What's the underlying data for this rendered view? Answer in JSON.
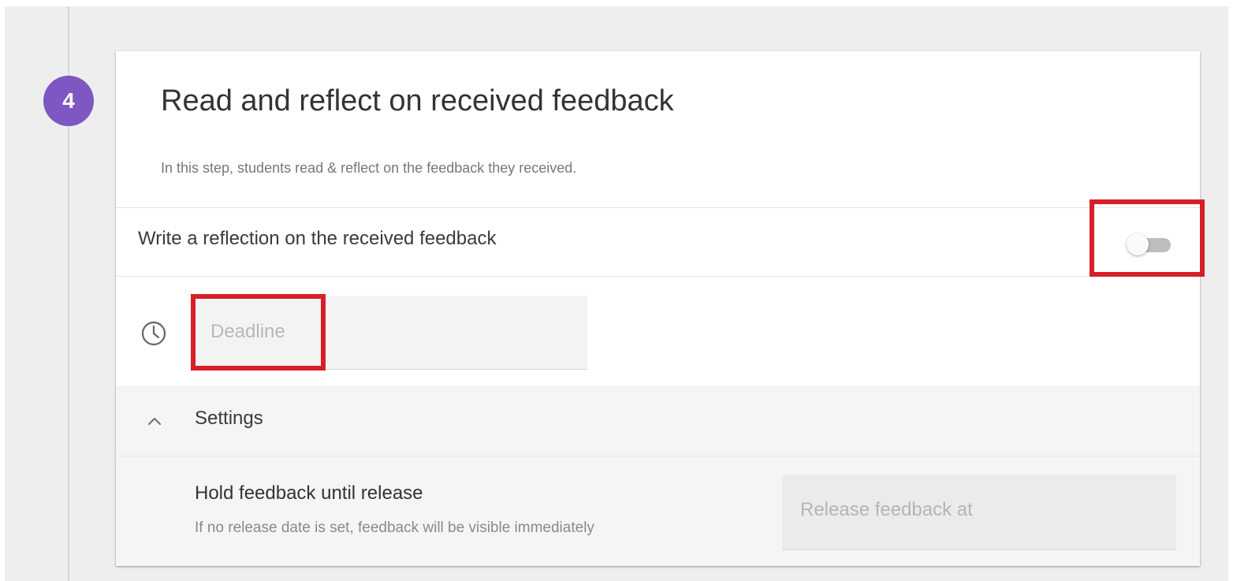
{
  "step": {
    "number": "4",
    "title": "Read and reflect on received feedback",
    "description": "In this step, students read & reflect on the feedback they received."
  },
  "reflection": {
    "label": "Write a reflection on the received feedback",
    "enabled": false
  },
  "deadline": {
    "icon": "clock-icon",
    "placeholder": "Deadline"
  },
  "settings": {
    "label": "Settings",
    "expanded": true,
    "icon": "chevron-up-icon",
    "hold_title": "Hold feedback until release",
    "hold_help": "If no release date is set, feedback will be visible immediately",
    "release_placeholder": "Release feedback at"
  },
  "colors": {
    "step_badge": "#7e57c2",
    "highlight": "#d61f2a",
    "toggle_track": "#bdbdbd"
  }
}
